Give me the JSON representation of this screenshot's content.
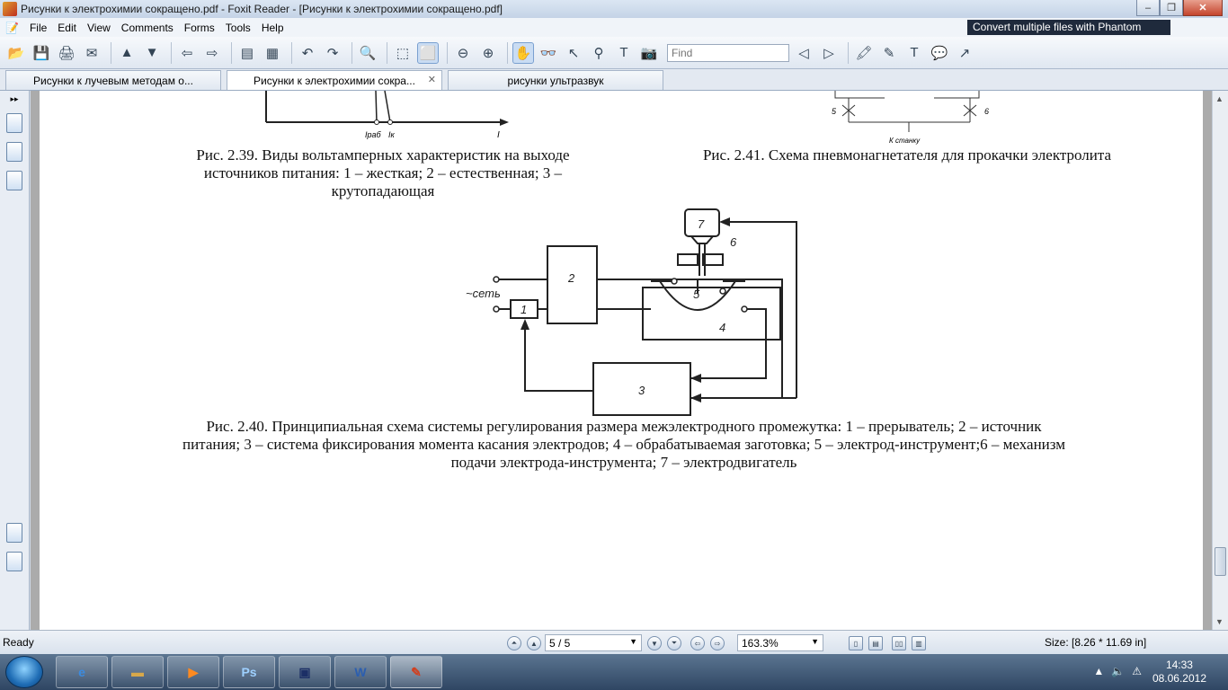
{
  "window": {
    "title": "Рисунки к электрохимии сокращено.pdf - Foxit Reader - [Рисунки к электрохимии сокращено.pdf]"
  },
  "menu": [
    "File",
    "Edit",
    "View",
    "Comments",
    "Forms",
    "Tools",
    "Help"
  ],
  "promo": "Convert multiple files with Phantom",
  "toolbar": {
    "find_placeholder": "Find"
  },
  "tabs": [
    {
      "label": "Рисунки к лучевым методам о...",
      "active": false
    },
    {
      "label": "Рисунки к электрохимии сокра...",
      "active": true
    },
    {
      "label": "рисунки ультразвук",
      "active": false
    }
  ],
  "page": {
    "fig239_axis": {
      "i_rab": "Iраб",
      "i_k": "Iк",
      "i": "I"
    },
    "fig239_caption": [
      "Рис. 2.39. Виды вольтамперных характеристик на выходе",
      "источников питания: 1 – жесткая; 2 – естественная; 3 –",
      "крутопадающая"
    ],
    "fig241_labels": {
      "left": "5",
      "right": "6",
      "bottom": "К станку"
    },
    "fig241_caption": "Рис. 2.41. Схема пневмонагнетателя для прокачки электролита",
    "fig240_labels": {
      "mains": "~сеть",
      "b1": "1",
      "b2": "2",
      "b3": "3",
      "b4": "4",
      "b5": "5",
      "b6": "6",
      "b7": "7"
    },
    "fig240_caption": [
      "Рис. 2.40. Принципиальная схема системы регулирования размера межэлектродного промежутка: 1 – прерыватель; 2 – источник",
      "питания; 3 – система фиксирования момента касания электродов; 4 – обрабатываемая заготовка; 5 – электрод-инструмент;6 – механизм",
      "подачи электрода-инструмента; 7 – электродвигатель"
    ]
  },
  "status": {
    "ready": "Ready",
    "page": "5 / 5",
    "zoom": "163.3%",
    "size": "Size: [8.26 * 11.69 in]"
  },
  "taskbar": {
    "time": "14:33",
    "date": "08.06.2012"
  }
}
